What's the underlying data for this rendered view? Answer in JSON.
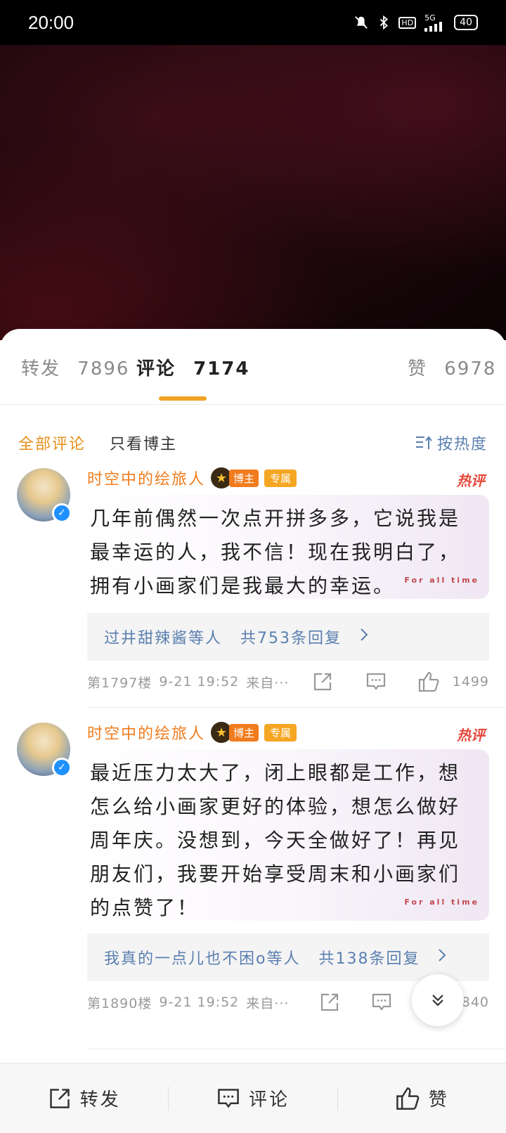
{
  "status_bar": {
    "time": "20:00",
    "network": "5G",
    "hd": "HD",
    "battery": "40"
  },
  "tabs": [
    {
      "label": "转发",
      "count": "7896"
    },
    {
      "label": "评论",
      "count": "7174"
    },
    {
      "label": "赞",
      "count": "6978"
    }
  ],
  "filters": {
    "all": "全部评论",
    "owner_only": "只看博主",
    "sort": "按热度"
  },
  "comments": [
    {
      "username": "时空中的绘旅人",
      "badge_owner": "博主",
      "badge_exclusive": "专属",
      "hot_label": "热评",
      "lines": [
        "几年前偶然一次点开拼多多，它说我是",
        "最幸运的人，我不信！现在我明白了，",
        "拥有小画家们是我最大的幸运。"
      ],
      "bubble_deco": "For all time",
      "replies_from": "过井甜辣酱等人",
      "replies_count": "共753条回复",
      "floor": "第1797楼",
      "time": "9-21 19:52",
      "source": "来自···",
      "likes": "1499"
    },
    {
      "username": "时空中的绘旅人",
      "badge_owner": "博主",
      "badge_exclusive": "专属",
      "hot_label": "热评",
      "lines": [
        "最近压力太大了，闭上眼都是工作，想",
        "怎么给小画家更好的体验，想怎么做好",
        "周年庆。没想到，今天全做好了！再见",
        "朋友们，我要开始享受周末和小画家们",
        "的点赞了！"
      ],
      "bubble_deco": "For all time",
      "replies_from": "我真的一点儿也不困o等人",
      "replies_count": "共138条回复",
      "floor": "第1890楼",
      "time": "9-21 19:52",
      "source": "来自···",
      "likes": "840"
    }
  ],
  "bottom_bar": {
    "repost": "转发",
    "comment": "评论",
    "like": "赞"
  }
}
